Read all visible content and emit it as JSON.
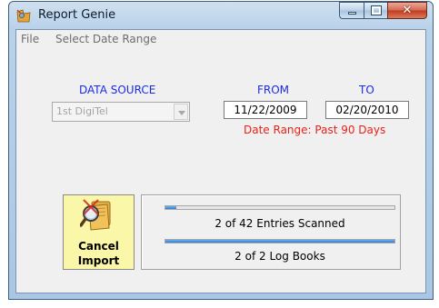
{
  "window": {
    "title": "Report Genie",
    "caption_buttons": {
      "minimize": "minimize-icon",
      "maximize": "maximize-icon",
      "close": "✕"
    }
  },
  "menu": {
    "items": [
      "File",
      "Select Date Range"
    ]
  },
  "data_source": {
    "label": "DATA SOURCE",
    "selected": "1st DigiTel"
  },
  "from": {
    "label": "FROM",
    "value": "11/22/2009"
  },
  "to": {
    "label": "TO",
    "value": "02/20/2010"
  },
  "date_range_text": "Date Range:  Past 90 Days",
  "cancel_button": {
    "line1": "Cancel",
    "line2": "Import",
    "icon": "folder-search-icon"
  },
  "progress": {
    "entries": {
      "text": "2 of 42 Entries Scanned",
      "fraction": 0.048
    },
    "logbooks": {
      "text": "2 of 2 Log Books",
      "fraction": 1.0
    }
  },
  "colors": {
    "label_blue": "#1a2be8",
    "range_red": "#e8211b",
    "button_yellow": "#fbf7a9",
    "progress_blue": "#2f7fd6"
  }
}
